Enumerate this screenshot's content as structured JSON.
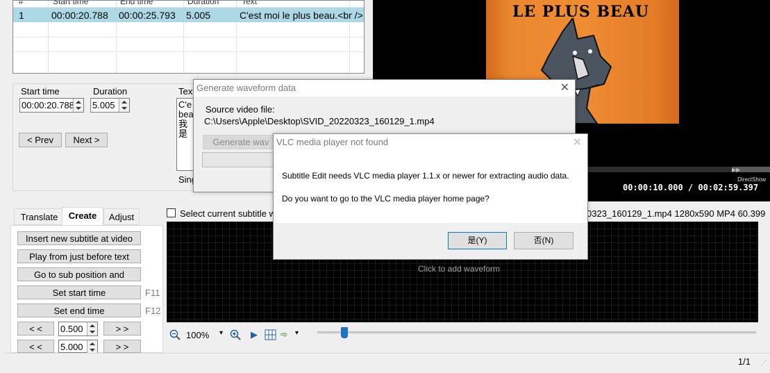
{
  "grid": {
    "columns": [
      "#",
      "Start time",
      "End time",
      "Duration",
      "Text"
    ],
    "rows": [
      {
        "num": "1",
        "start": "00:00:20.788",
        "end": "00:00:25.793",
        "duration": "5.005",
        "text": "C'est moi le plus beau.<br />"
      }
    ]
  },
  "edit": {
    "start_label": "Start time",
    "duration_label": "Duration",
    "text_label": "Text",
    "start_value": "00:00:20.788",
    "duration_value": "5.005",
    "text_lines": [
      "C'e",
      "bea",
      "我是"
    ],
    "prev": "< Prev",
    "next": "Next >",
    "single_label": "Sing"
  },
  "video": {
    "poster_title": "LE PLUS BEAU",
    "engine": "DirectShow",
    "time": "00:00:10.000 / 00:02:59.397"
  },
  "tabs": {
    "items": [
      "Translate",
      "Create",
      "Adjust"
    ],
    "active": "Create",
    "buttons": {
      "insert": "Insert new subtitle at video",
      "play_before": "Play from just before text",
      "goto_sub": "Go to sub position and",
      "set_start": "Set start time",
      "set_end": "Set end time",
      "back": "< <",
      "forward": "> >"
    },
    "keys": {
      "set_start": "F11",
      "set_end": "F12"
    },
    "step1": "0.500",
    "step2": "5.000"
  },
  "waveform": {
    "select_current": "Select current subtitle w",
    "file_info": "0323_160129_1.mp4 1280x590 MP4 60.399",
    "hint": "Click to add waveform",
    "zoom": "100%"
  },
  "generate_dialog": {
    "title": "Generate waveform data",
    "source_label": "Source video file:",
    "source_path": "C:\\Users\\Apple\\Desktop\\SVID_20220323_160129_1.mp4",
    "generate_button": "Generate wav"
  },
  "vlc_dialog": {
    "title": "VLC media player not found",
    "message1": "Subtitle Edit needs VLC media player 1.1.x or newer for extracting audio data.",
    "message2": "Do you want to go to the VLC media player home page?",
    "yes": "是(Y)",
    "no": "否(N)"
  },
  "status": {
    "page": "1/1"
  }
}
